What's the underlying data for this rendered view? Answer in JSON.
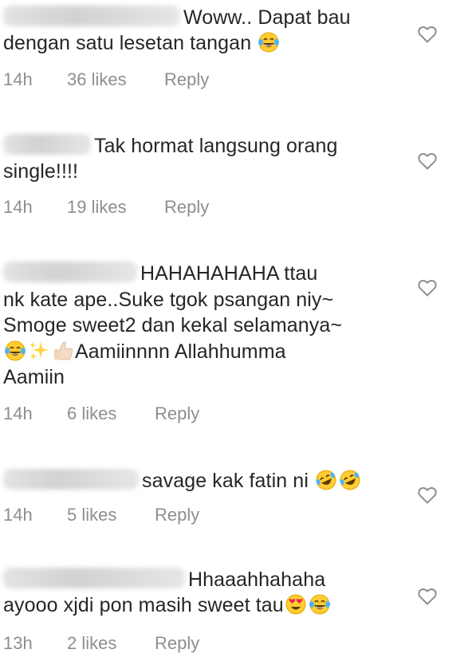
{
  "comments": [
    {
      "username": "",
      "text": "Woww.. Dapat bau dengan satu lesetan tangan",
      "text_lines": [
        "Woww.. Dapat bau",
        "dengan satu lesetan tangan"
      ],
      "emojis": [
        "laughing-tears"
      ],
      "time": "14h",
      "likes": "36 likes",
      "reply": "Reply"
    },
    {
      "username": "",
      "text_lines": [
        "Tak hormat langsung orang",
        "single!!!!"
      ],
      "emojis": [],
      "time": "14h",
      "likes": "19 likes",
      "reply": "Reply"
    },
    {
      "username": "",
      "text_lines": [
        "HAHAHAHAHA ttau",
        "nk kate ape..Suke tgok psangan niy~",
        "Smoge sweet2 dan kekal selamanya~",
        "Aamiinnnn Allahhumma",
        "Aamiin"
      ],
      "emojis": [
        "laughing-tears",
        "sparkles",
        "thumbs-up"
      ],
      "time": "14h",
      "likes": "6 likes",
      "reply": "Reply"
    },
    {
      "username": "",
      "text_lines": [
        "savage kak fatin ni"
      ],
      "emojis": [
        "rolling-laughing",
        "rolling-laughing"
      ],
      "time": "14h",
      "likes": "5 likes",
      "reply": "Reply"
    },
    {
      "username": "",
      "text_lines": [
        "Hhaaahhahaha",
        "ayooo xjdi pon masih sweet tau"
      ],
      "emojis": [
        "heart-eyes",
        "laughing-tears"
      ],
      "time": "13h",
      "likes": "2 likes",
      "reply": "Reply"
    }
  ],
  "colors": {
    "text": "#262626",
    "meta": "#8e8e8e",
    "heart_outline": "#8e8e8e",
    "emoji_yellow": "#ffcc33"
  }
}
